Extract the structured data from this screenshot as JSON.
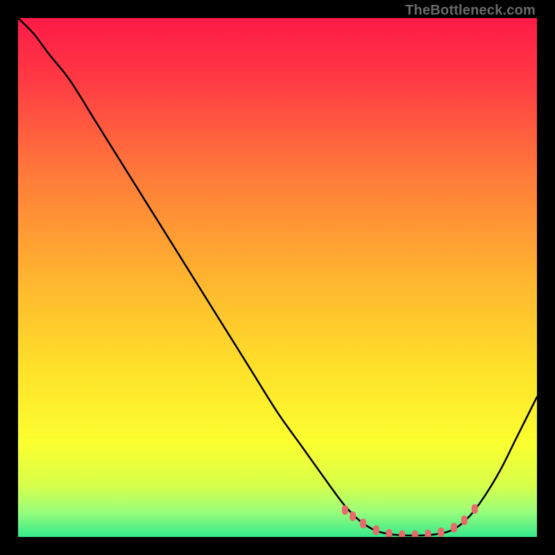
{
  "attribution": "TheBottleneck.com",
  "colors": {
    "background": "#000000",
    "gradient_top": "#ff1a47",
    "gradient_bottom": "#35e98c",
    "curve_stroke": "#000000",
    "marker_fill": "#e86a6a"
  },
  "chart_data": {
    "type": "line",
    "title": "",
    "xlabel": "",
    "ylabel": "",
    "x_range": [
      0,
      100
    ],
    "y_range": [
      0,
      100
    ],
    "series": [
      {
        "name": "bottleneck-curve",
        "x": [
          0,
          3,
          6,
          10,
          15,
          20,
          25,
          30,
          35,
          40,
          45,
          50,
          55,
          60,
          63,
          66,
          69,
          72,
          75,
          78,
          81,
          84,
          87,
          90,
          93,
          96,
          100
        ],
        "y": [
          100,
          97,
          93,
          88,
          80,
          72,
          64,
          56,
          48,
          40,
          32,
          24,
          17,
          10,
          6,
          3,
          1.2,
          0.5,
          0.3,
          0.3,
          0.6,
          1.5,
          4,
          8,
          13,
          19,
          27
        ]
      }
    ],
    "markers": {
      "name": "optimal-range",
      "x": [
        63,
        64.5,
        66.5,
        69,
        71.5,
        74,
        76.5,
        79,
        81.5,
        84,
        86,
        88
      ],
      "y": [
        5.2,
        4.0,
        2.6,
        1.3,
        0.6,
        0.35,
        0.35,
        0.5,
        0.9,
        1.8,
        3.2,
        5.4
      ]
    }
  }
}
